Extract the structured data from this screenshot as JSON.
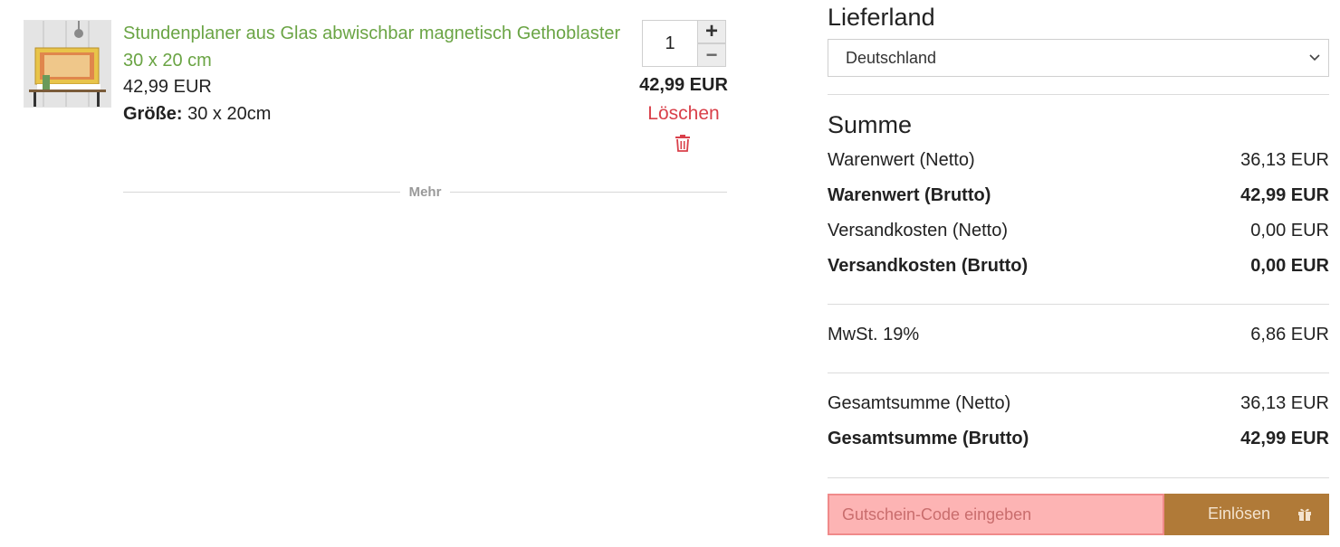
{
  "cart_item": {
    "title": "Stundenplaner aus Glas abwischbar magnetisch Gethoblaster 30 x 20 cm",
    "price": "42,99 EUR",
    "size_label": "Größe:",
    "size_value": "30 x 20cm",
    "quantity": "1",
    "qty_plus": "+",
    "qty_minus": "−",
    "line_total": "42,99 EUR",
    "delete_label": "Löschen"
  },
  "more_label": "Mehr",
  "shipping": {
    "heading": "Lieferland",
    "country": "Deutschland"
  },
  "summary": {
    "heading": "Summe",
    "rows": [
      {
        "label": "Warenwert (Netto)",
        "value": "36,13 EUR"
      },
      {
        "label": "Warenwert (Brutto)",
        "value": "42,99 EUR"
      },
      {
        "label": "Versandkosten (Netto)",
        "value": "0,00 EUR"
      },
      {
        "label": "Versandkosten (Brutto)",
        "value": "0,00 EUR"
      },
      {
        "label": "MwSt. 19%",
        "value": "6,86 EUR"
      },
      {
        "label": "Gesamtsumme (Netto)",
        "value": "36,13 EUR"
      },
      {
        "label": "Gesamtsumme (Brutto)",
        "value": "42,99 EUR"
      }
    ]
  },
  "coupon": {
    "placeholder": "Gutschein-Code eingeben",
    "button_label": "Einlösen"
  },
  "colors": {
    "product_link": "#6aa444",
    "delete": "#d9404a",
    "coupon_button": "#b07a38",
    "coupon_input_bg": "#fdb4b4"
  },
  "icons": [
    "trash-icon",
    "chevron-down-icon",
    "gift-icon"
  ]
}
